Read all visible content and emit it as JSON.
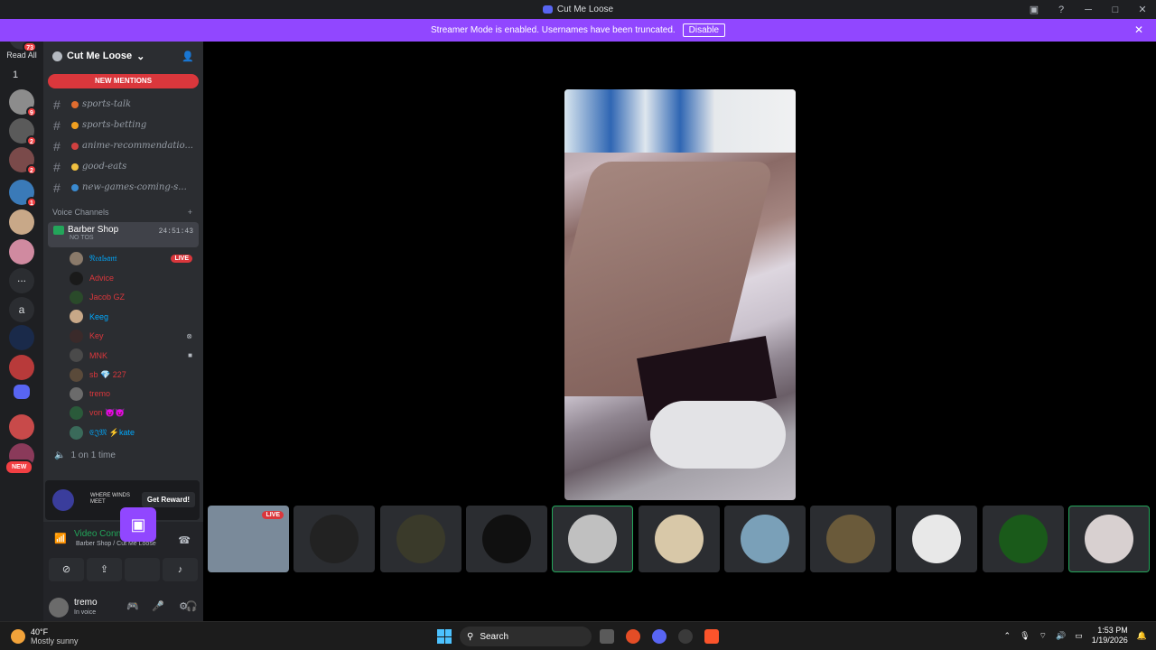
{
  "window": {
    "title": "Cut Me Loose",
    "controls": [
      "▣",
      "?",
      "─",
      "□",
      "✕"
    ]
  },
  "banner": {
    "text": "Streamer Mode is enabled. Usernames have been truncated.",
    "button": "Disable",
    "close": "✕"
  },
  "guilds": {
    "top_badge": "73",
    "read_all": "Read All",
    "dm_label": "1",
    "items": [
      {
        "color": "#8c8c8c",
        "badge": "9"
      },
      {
        "color": "#5a5a5a",
        "badge": "2"
      },
      {
        "color": "#7a4a4a",
        "badge": "2"
      },
      {
        "color": "#3a7ab8",
        "badge": "1"
      },
      {
        "color": "#c8a888",
        "badge": ""
      },
      {
        "color": "#d08aa0",
        "badge": ""
      },
      {
        "color": "#2b2d31",
        "badge": ""
      },
      {
        "color": "#2b2d31",
        "badge": ""
      },
      {
        "color": "#1a2a4a",
        "badge": ""
      },
      {
        "color": "#b83a3a",
        "badge": ""
      },
      {
        "color": "#5865f2",
        "badge": ""
      },
      {
        "color": "#c84a4a",
        "badge": ""
      },
      {
        "color": "#8a3a5a",
        "badge": ""
      }
    ],
    "more_label": "...",
    "letter_label": "a",
    "new_label": "NEW"
  },
  "server": {
    "name": "Cut Me Loose",
    "new_mentions": "NEW MENTIONS",
    "text_channels": [
      {
        "name": "sports-talk",
        "emoji_color": "#e06c2f"
      },
      {
        "name": "sports-betting",
        "emoji_color": "#f0a020"
      },
      {
        "name": "anime-recommendatio...",
        "emoji_color": "#d04040"
      },
      {
        "name": "good-eats",
        "emoji_color": "#f0c040"
      },
      {
        "name": "new-games-coming-s...",
        "emoji_color": "#3a8ad0"
      }
    ],
    "voice_category": "Voice Channels",
    "voice_channel": {
      "name": "Barber Shop",
      "status": "NO TOS",
      "timer": "24:51:43"
    },
    "voice_users": [
      {
        "name": "𝔑𝔢𝔞𝔩𝔰𝔞𝔫𝔱",
        "color": "#00a8fc",
        "avatar": "#8a7a6a",
        "live": "LIVE",
        "right": ""
      },
      {
        "name": "Advice",
        "color": "#da373c",
        "avatar": "#1a1a1a",
        "live": "",
        "right": ""
      },
      {
        "name": "Jacob GZ",
        "color": "#da373c",
        "avatar": "#2a4a2a",
        "live": "",
        "right": ""
      },
      {
        "name": "Keeg",
        "color": "#00a8fc",
        "avatar": "#c8a888",
        "live": "",
        "right": ""
      },
      {
        "name": "Key",
        "color": "#da373c",
        "avatar": "#3a2a2a",
        "live": "",
        "right": "⊗"
      },
      {
        "name": "MNK",
        "color": "#da373c",
        "avatar": "#4a4a4a",
        "live": "",
        "right": "■"
      },
      {
        "name": "sb  💎 227",
        "color": "#da373c",
        "avatar": "#5a4a3a",
        "live": "",
        "right": ""
      },
      {
        "name": "tremo",
        "color": "#da373c",
        "avatar": "#6b6b6b",
        "live": "",
        "right": ""
      },
      {
        "name": "von 😈😈",
        "color": "#da373c",
        "avatar": "#2a5a3a",
        "live": "",
        "right": ""
      },
      {
        "name": "𝔈𝔍𝔐 ⚡kate",
        "color": "#00a8fc",
        "avatar": "#3a6a5a",
        "live": "",
        "right": ""
      }
    ],
    "other_voice": "1 on 1 time"
  },
  "promo": {
    "text": "WHERE WINDS MEET",
    "button": "Get Reward!"
  },
  "voice_panel": {
    "status": "Video Connected",
    "location": "Barber Shop / Cut Me Loose"
  },
  "user": {
    "name": "tremo",
    "status": "In voice"
  },
  "stage": {
    "strip_live": "LIVE",
    "strip": [
      {
        "color": "#7a8a9a",
        "selected": false
      },
      {
        "color": "#222222",
        "selected": false
      },
      {
        "color": "#3a3a2a",
        "selected": false
      },
      {
        "color": "#101010",
        "selected": false
      },
      {
        "color": "#c0c0c0",
        "selected": true
      },
      {
        "color": "#d8c8a8",
        "selected": false
      },
      {
        "color": "#7aa0b8",
        "selected": false
      },
      {
        "color": "#6a5a3a",
        "selected": false
      },
      {
        "color": "#e8e8e8",
        "selected": false
      },
      {
        "color": "#1a5a1a",
        "selected": false
      },
      {
        "color": "#d8d0d0",
        "selected": true
      }
    ]
  },
  "taskbar": {
    "temp": "40°F",
    "weather": "Mostly sunny",
    "search": "Search",
    "time": "1:53 PM",
    "date": "1/19/2026"
  }
}
